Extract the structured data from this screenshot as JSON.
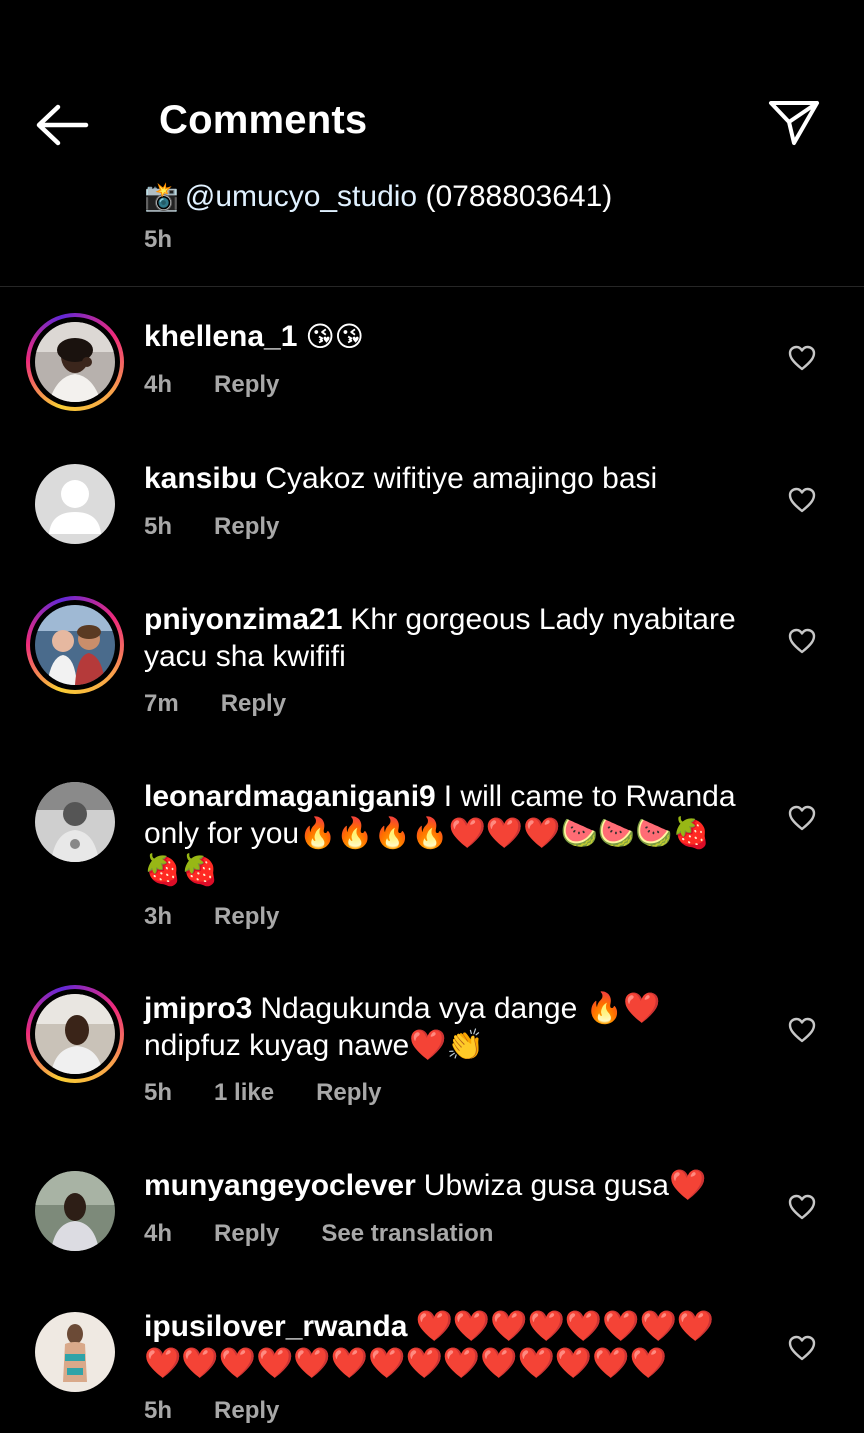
{
  "header": {
    "title": "Comments",
    "back_icon": "arrow-left-icon",
    "share_icon": "paper-plane-icon"
  },
  "caption": {
    "camera_emoji": "📸",
    "mention": "@umucyo_studio",
    "text": " (0788803641)",
    "time": "5h"
  },
  "comments": [
    {
      "username": "khellena_1",
      "text": "😘😘",
      "time": "4h",
      "likes": "",
      "reply": "Reply",
      "translate": ""
    },
    {
      "username": "kansibu",
      "text": "Cyakoz wifitiye amajingo basi",
      "time": "5h",
      "likes": "",
      "reply": "Reply",
      "translate": ""
    },
    {
      "username": "pniyonzima21",
      "text": "Khr gorgeous Lady nyabitare yacu sha kwififi",
      "time": "7m",
      "likes": "",
      "reply": "Reply",
      "translate": ""
    },
    {
      "username": "leonardmaganigani9",
      "text": "I will came to Rwanda only for you🔥🔥🔥🔥❤️❤️❤️🍉🍉🍉🍓🍓🍓",
      "time": "3h",
      "likes": "",
      "reply": "Reply",
      "translate": ""
    },
    {
      "username": "jmipro3",
      "text": "Ndagukunda vya dange 🔥❤️ ndipfuz kuyag nawe❤️👏",
      "time": "5h",
      "likes": "1 like",
      "reply": "Reply",
      "translate": ""
    },
    {
      "username": "munyangeyoclever",
      "text": "Ubwiza gusa gusa❤️",
      "time": "4h",
      "likes": "",
      "reply": "Reply",
      "translate": "See translation"
    },
    {
      "username": "ipusilover_rwanda",
      "text": "❤️❤️❤️❤️❤️❤️❤️❤️❤️❤️❤️❤️❤️❤️❤️❤️❤️❤️❤️❤️❤️❤️",
      "time": "5h",
      "likes": "",
      "reply": "Reply",
      "translate": ""
    }
  ],
  "colors": {
    "background": "#000000",
    "secondary_text": "#a8a8a8",
    "divider": "#262626"
  }
}
